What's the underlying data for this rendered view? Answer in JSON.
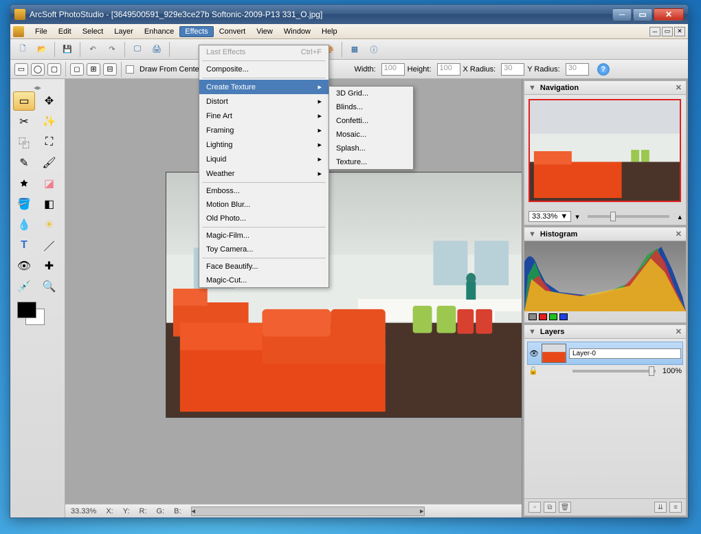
{
  "window": {
    "title": "ArcSoft PhotoStudio - [3649500591_929e3ce27b Softonic-2009-P13 331_O.jpg]"
  },
  "menu": {
    "items": [
      "File",
      "Edit",
      "Select",
      "Layer",
      "Enhance",
      "Effects",
      "Convert",
      "View",
      "Window",
      "Help"
    ],
    "active": "Effects"
  },
  "effects_menu": {
    "last_effects": "Last Effects",
    "last_effects_shortcut": "Ctrl+F",
    "composite": "Composite...",
    "create_texture": "Create Texture",
    "distort": "Distort",
    "fine_art": "Fine Art",
    "framing": "Framing",
    "lighting": "Lighting",
    "liquid": "Liquid",
    "weather": "Weather",
    "emboss": "Emboss...",
    "motion_blur": "Motion Blur...",
    "old_photo": "Old Photo...",
    "magic_film": "Magic-Film...",
    "toy_camera": "Toy Camera...",
    "face_beautify": "Face Beautify...",
    "magic_cut": "Magic-Cut..."
  },
  "texture_submenu": {
    "grid3d": "3D Grid...",
    "blinds": "Blinds...",
    "confetti": "Confetti...",
    "mosaic": "Mosaic...",
    "splash": "Splash...",
    "texture": "Texture..."
  },
  "options": {
    "draw_from_center": "Draw From Center",
    "width_label": "Width:",
    "width": "100",
    "height_label": "Height:",
    "height": "100",
    "xradius_label": "X Radius:",
    "xradius": "30",
    "yradius_label": "Y Radius:",
    "yradius": "30"
  },
  "panels": {
    "navigation": {
      "title": "Navigation",
      "zoom": "33.33%"
    },
    "histogram": {
      "title": "Histogram"
    },
    "layers": {
      "title": "Layers",
      "layer0": "Layer-0",
      "opacity": "100%"
    }
  },
  "status": {
    "zoom": "33.33%",
    "x": "X:",
    "y": "Y:",
    "r": "R:",
    "g": "G:",
    "b": "B:"
  }
}
